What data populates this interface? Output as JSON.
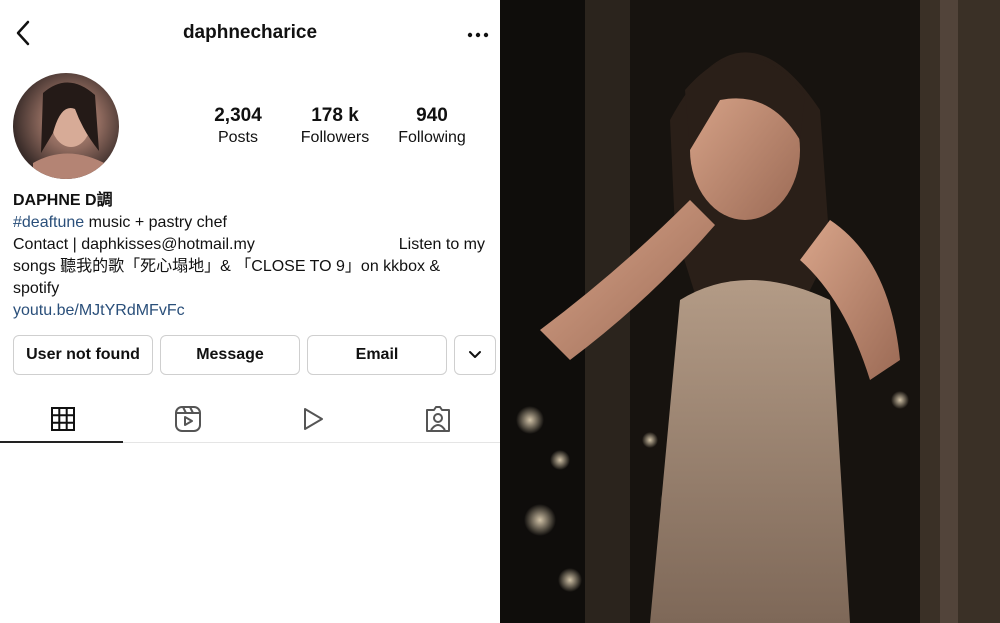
{
  "header": {
    "username": "daphnecharice"
  },
  "stats": {
    "posts_num": "2,304",
    "posts_label": "Posts",
    "followers_num": "178 k",
    "followers_label": "Followers",
    "following_num": "940",
    "following_label": "Following"
  },
  "bio": {
    "name": "DAPHNE D調",
    "hashtag": "#deaftune",
    "line1_rest": " music + pastry chef",
    "contact": "Contact | daphkisses@hotmail.my",
    "listen": "Listen to my",
    "line3": "songs 聽我的歌「死心塌地」& 「CLOSE TO 9」on kkbox &",
    "line4": "spotify",
    "link": "youtu.be/MJtYRdMFvFc"
  },
  "buttons": {
    "user": "User not found",
    "message": "Message",
    "email": "Email"
  },
  "icons": {
    "back": "back-arrow-icon",
    "more": "more-icon",
    "chevron": "chevron-down-icon",
    "grid": "grid-icon",
    "reels": "reels-icon",
    "video": "video-play-icon",
    "tagged": "tagged-icon"
  },
  "colors": {
    "link": "#2a4f7a",
    "text": "#111111"
  }
}
